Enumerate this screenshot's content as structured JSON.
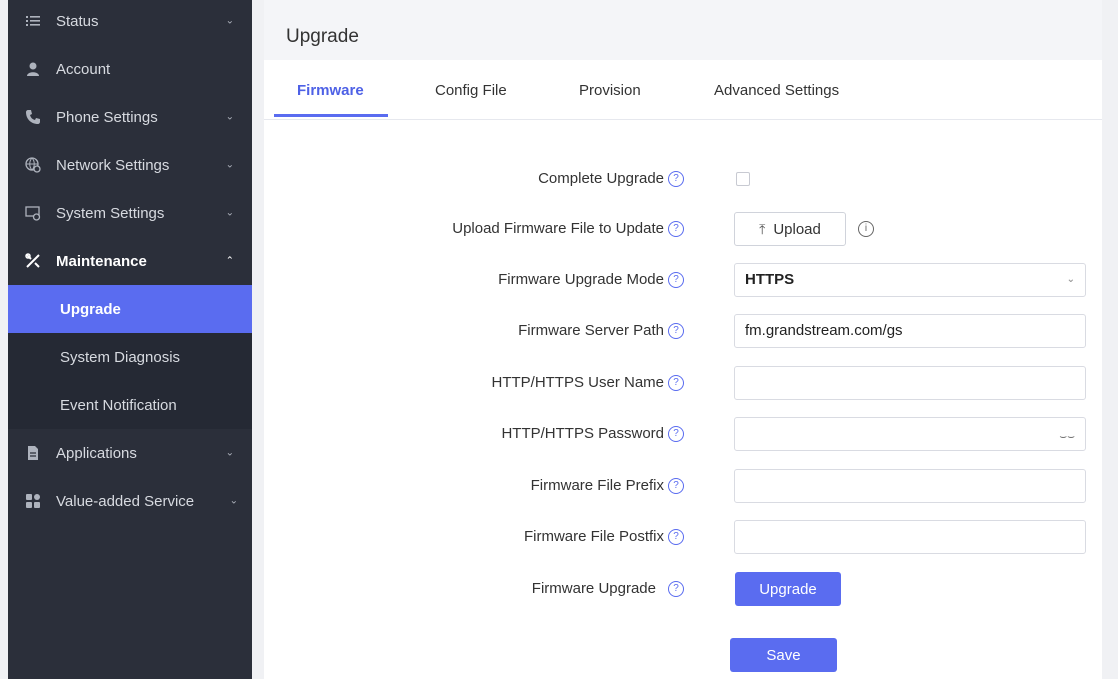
{
  "sidebar": {
    "items": [
      {
        "label": "Status",
        "icon": "list-icon"
      },
      {
        "label": "Account",
        "icon": "user-icon"
      },
      {
        "label": "Phone Settings",
        "icon": "phone-icon"
      },
      {
        "label": "Network Settings",
        "icon": "network-icon"
      },
      {
        "label": "System Settings",
        "icon": "system-settings-icon"
      },
      {
        "label": "Maintenance",
        "icon": "tools-icon"
      },
      {
        "label": "Applications",
        "icon": "document-icon"
      },
      {
        "label": "Value-added Service",
        "icon": "grid-icon"
      }
    ],
    "maintenance_sub": [
      "Upgrade",
      "System Diagnosis",
      "Event Notification"
    ]
  },
  "main": {
    "title": "Upgrade",
    "tabs": [
      "Firmware",
      "Config File",
      "Provision",
      "Advanced Settings"
    ]
  },
  "form": {
    "complete_upgrade_label": "Complete Upgrade",
    "upload_label": "Upload Firmware File to Update",
    "upload_button": "Upload",
    "mode_label": "Firmware Upgrade Mode",
    "mode_value": "HTTPS",
    "server_path_label": "Firmware Server Path",
    "server_path_value": "fm.grandstream.com/gs",
    "username_label": "HTTP/HTTPS User Name",
    "username_value": "",
    "password_label": "HTTP/HTTPS Password",
    "password_value": "",
    "prefix_label": "Firmware File Prefix",
    "prefix_value": "",
    "postfix_label": "Firmware File Postfix",
    "postfix_value": "",
    "firmware_upgrade_label": "Firmware Upgrade",
    "upgrade_button": "Upgrade",
    "save_button": "Save"
  },
  "colors": {
    "accent": "#5a6cf0",
    "sidebar_bg": "#2b2f3a"
  }
}
